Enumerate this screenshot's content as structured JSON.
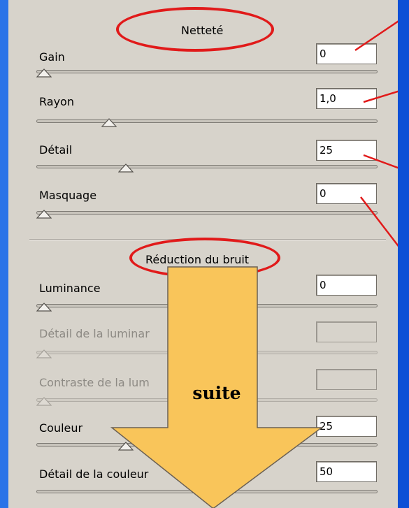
{
  "sharpening": {
    "title": "Netteté",
    "rows": [
      {
        "label": "Gain",
        "value": "0",
        "slider_fraction": 0.0
      },
      {
        "label": "Rayon",
        "value": "1,0",
        "slider_fraction": 0.2
      },
      {
        "label": "Détail",
        "value": "25",
        "slider_fraction": 0.25
      },
      {
        "label": "Masquage",
        "value": "0",
        "slider_fraction": 0.0
      }
    ]
  },
  "noise_reduction": {
    "title": "Réduction du bruit",
    "rows": [
      {
        "label": "Luminance",
        "value": "0",
        "slider_fraction": 0.0,
        "enabled": true
      },
      {
        "label": "Détail de la luminar",
        "value": "",
        "slider_fraction": 0.0,
        "enabled": false
      },
      {
        "label": "Contraste de la lum",
        "value": "",
        "slider_fraction": 0.0,
        "enabled": false
      },
      {
        "label": "Couleur",
        "value": "25",
        "slider_fraction": 0.25,
        "enabled": true
      },
      {
        "label": "Détail de la couleur",
        "value": "50",
        "slider_fraction": 0.5,
        "enabled": true
      }
    ]
  },
  "annotation": {
    "arrow_label": "suite",
    "arrow_color": "#f9c55a",
    "highlight_color": "#e11a1a"
  },
  "colors": {
    "panel_bg": "#d7d3cb",
    "frame_bg": "#2a73e8"
  }
}
